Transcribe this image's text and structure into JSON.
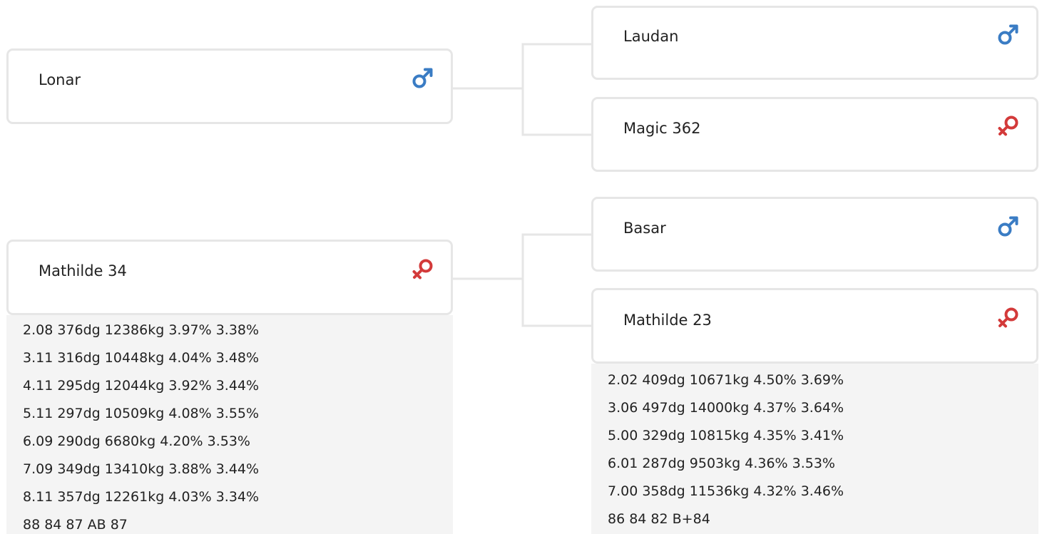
{
  "pedigree": {
    "sire": {
      "name": "Lonar",
      "sex": "male",
      "sire": {
        "name": "Laudan",
        "sex": "male"
      },
      "dam": {
        "name": "Magic 362",
        "sex": "female"
      }
    },
    "dam": {
      "name": "Mathilde 34",
      "sex": "female",
      "stats": [
        "2.08 376dg 12386kg 3.97% 3.38%",
        "3.11 316dg 10448kg 4.04% 3.48%",
        "4.11 295dg 12044kg 3.92% 3.44%",
        "5.11 297dg 10509kg 4.08% 3.55%",
        "6.09 290dg 6680kg 4.20% 3.53%",
        "7.09 349dg 13410kg 3.88% 3.44%",
        "8.11 357dg 12261kg 4.03% 3.34%",
        "88 84 87 AB 87"
      ],
      "sire": {
        "name": "Basar",
        "sex": "male"
      },
      "dam": {
        "name": "Mathilde 23",
        "sex": "female",
        "stats": [
          "2.02 409dg 10671kg 4.50% 3.69%",
          "3.06 497dg 14000kg 4.37% 3.64%",
          "5.00 329dg 10815kg 4.35% 3.41%",
          "6.01 287dg 9503kg 4.36% 3.53%",
          "7.00 358dg 11536kg 4.32% 3.46%",
          "86 84 82 B+84"
        ]
      }
    }
  },
  "colors": {
    "male": "#3a7cc4",
    "female": "#d33a3a",
    "border": "#e6e6e6",
    "stats_bg": "#f4f4f4"
  }
}
